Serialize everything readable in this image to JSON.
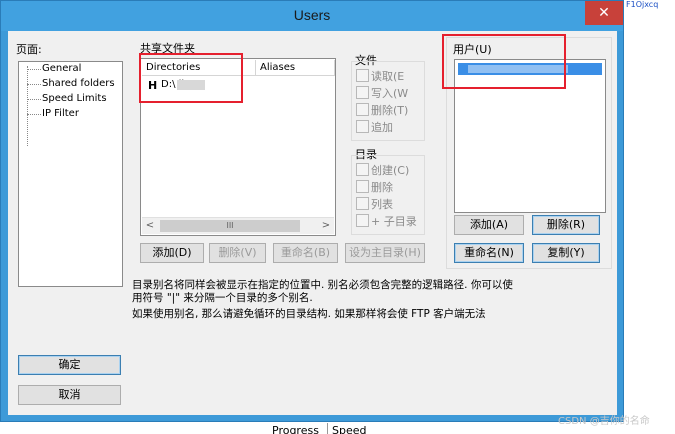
{
  "window": {
    "title": "Users",
    "close_glyph": "✕"
  },
  "left": {
    "label": "页面:",
    "tree": [
      "General",
      "Shared folders",
      "Speed Limits",
      "IP Filter"
    ],
    "ok": "确定",
    "cancel": "取消"
  },
  "shared": {
    "label": "共享文件夹",
    "columns": [
      "Directories",
      "Aliases"
    ],
    "row_prefix": "H",
    "row_text": "D:\\ ile",
    "scroll_left": "<",
    "scroll_right": ">",
    "scroll_thumb": "III",
    "buttons": [
      "添加(D)",
      "删除(V)",
      "重命名(B)",
      "设为主目录(H)"
    ]
  },
  "files": {
    "label": "文件",
    "items": [
      "读取(E",
      "写入(W",
      "删除(T)",
      "追加"
    ]
  },
  "dirs": {
    "label": "目录",
    "items": [
      "创建(C)",
      "删除",
      "列表",
      "+ 子目录"
    ]
  },
  "users": {
    "label": "用户(U)",
    "buttons": [
      "添加(A)",
      "删除(R)",
      "重命名(N)",
      "复制(Y)"
    ]
  },
  "notes": [
    "目录别名将同样会被显示在指定的位置中. 别名必须包含完整的逻辑路径. 你可以使",
    "用符号 \"|\" 来分隔一个目录的多个别名.",
    "如果使用别名, 那么请避免循环的目录结构. 如果那样将会使 FTP 客户端无法"
  ],
  "bottom": {
    "progress": "Progress",
    "speed": "Speed"
  },
  "watermark": "CSDN @吉你的名命",
  "corner_text": "F1Ojxcq"
}
